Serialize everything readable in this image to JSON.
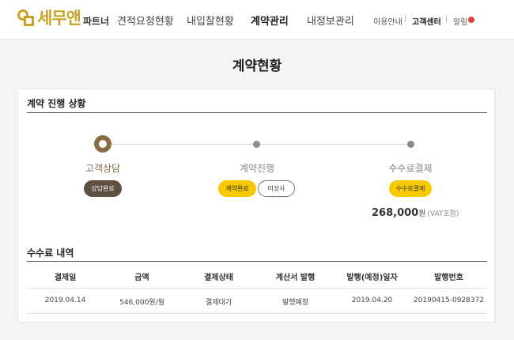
{
  "header": {
    "logo": {
      "main": "세무앤",
      "sub": "파트너"
    },
    "nav": [
      {
        "label": "견적요청현황",
        "active": false
      },
      {
        "label": "내입찰현황",
        "active": false
      },
      {
        "label": "계약관리",
        "active": true
      },
      {
        "label": "내정보관리",
        "active": false
      }
    ],
    "utility": [
      {
        "label": "이용안내"
      },
      {
        "label": "고객센터"
      },
      {
        "label": "알림"
      }
    ]
  },
  "page": {
    "title": "계약현황"
  },
  "progress": {
    "section_title": "계약 진행 상황",
    "steps": [
      {
        "label": "고객상담",
        "current": true
      },
      {
        "label": "계약진행",
        "current": false
      },
      {
        "label": "수수료결제",
        "current": false
      }
    ],
    "buttons": {
      "consult_done": "상담완료",
      "contract_done": "계약완료",
      "not_registered": "미성사",
      "fee_payment": "수수료결제"
    },
    "fee": {
      "amount": "268,000",
      "unit": "원",
      "vat": "(VAT포함)"
    }
  },
  "fees": {
    "section_title": "수수료 내역",
    "columns": [
      "결제일",
      "금액",
      "결제상태",
      "계산서 발행",
      "발행(예정)일자",
      "발행번호"
    ],
    "rows": [
      [
        "2019.04.14",
        "546,000원/월",
        "결제대기",
        "발행예정",
        "2019.04.20",
        "20190415-0928372"
      ]
    ]
  },
  "colors": {
    "brand_gold": "#c9a227",
    "step_brown": "#8a6d45",
    "pill_dark": "#5e5042",
    "pill_yellow": "#f7c900",
    "alert_red": "#e0413a"
  }
}
